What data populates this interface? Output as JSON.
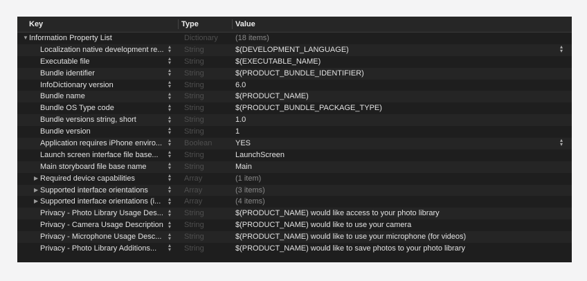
{
  "header": {
    "key": "Key",
    "type": "Type",
    "value": "Value"
  },
  "root": {
    "key": "Information Property List",
    "type": "Dictionary",
    "value": "(18 items)"
  },
  "rows": [
    {
      "key": "Localization native development re...",
      "type": "String",
      "value": "$(DEVELOPMENT_LANGUAGE)",
      "expandable": false,
      "value_popup": true
    },
    {
      "key": "Executable file",
      "type": "String",
      "value": "$(EXECUTABLE_NAME)",
      "expandable": false,
      "value_popup": false
    },
    {
      "key": "Bundle identifier",
      "type": "String",
      "value": "$(PRODUCT_BUNDLE_IDENTIFIER)",
      "expandable": false,
      "value_popup": false
    },
    {
      "key": "InfoDictionary version",
      "type": "String",
      "value": "6.0",
      "expandable": false,
      "value_popup": false
    },
    {
      "key": "Bundle name",
      "type": "String",
      "value": "$(PRODUCT_NAME)",
      "expandable": false,
      "value_popup": false
    },
    {
      "key": "Bundle OS Type code",
      "type": "String",
      "value": "$(PRODUCT_BUNDLE_PACKAGE_TYPE)",
      "expandable": false,
      "value_popup": false
    },
    {
      "key": "Bundle versions string, short",
      "type": "String",
      "value": "1.0",
      "expandable": false,
      "value_popup": false
    },
    {
      "key": "Bundle version",
      "type": "String",
      "value": "1",
      "expandable": false,
      "value_popup": false
    },
    {
      "key": "Application requires iPhone enviro...",
      "type": "Boolean",
      "value": "YES",
      "expandable": false,
      "value_popup": true
    },
    {
      "key": "Launch screen interface file base...",
      "type": "String",
      "value": "LaunchScreen",
      "expandable": false,
      "value_popup": false
    },
    {
      "key": "Main storyboard file base name",
      "type": "String",
      "value": "Main",
      "expandable": false,
      "value_popup": false
    },
    {
      "key": "Required device capabilities",
      "type": "Array",
      "value": "(1 item)",
      "expandable": true,
      "value_popup": false
    },
    {
      "key": "Supported interface orientations",
      "type": "Array",
      "value": "(3 items)",
      "expandable": true,
      "value_popup": false
    },
    {
      "key": "Supported interface orientations (i...",
      "type": "Array",
      "value": "(4 items)",
      "expandable": true,
      "value_popup": false
    },
    {
      "key": "Privacy - Photo Library Usage Des...",
      "type": "String",
      "value": "$(PRODUCT_NAME) would like access to your photo library",
      "expandable": false,
      "value_popup": false
    },
    {
      "key": "Privacy - Camera Usage Description",
      "type": "String",
      "value": "$(PRODUCT_NAME) would like to use your camera",
      "expandable": false,
      "value_popup": false
    },
    {
      "key": "Privacy - Microphone Usage Desc...",
      "type": "String",
      "value": "$(PRODUCT_NAME) would like to use your microphone (for videos)",
      "expandable": false,
      "value_popup": false
    },
    {
      "key": "Privacy - Photo Library Additions...",
      "type": "String",
      "value": "$(PRODUCT_NAME) would like to save photos to your photo library",
      "expandable": false,
      "value_popup": false
    }
  ]
}
